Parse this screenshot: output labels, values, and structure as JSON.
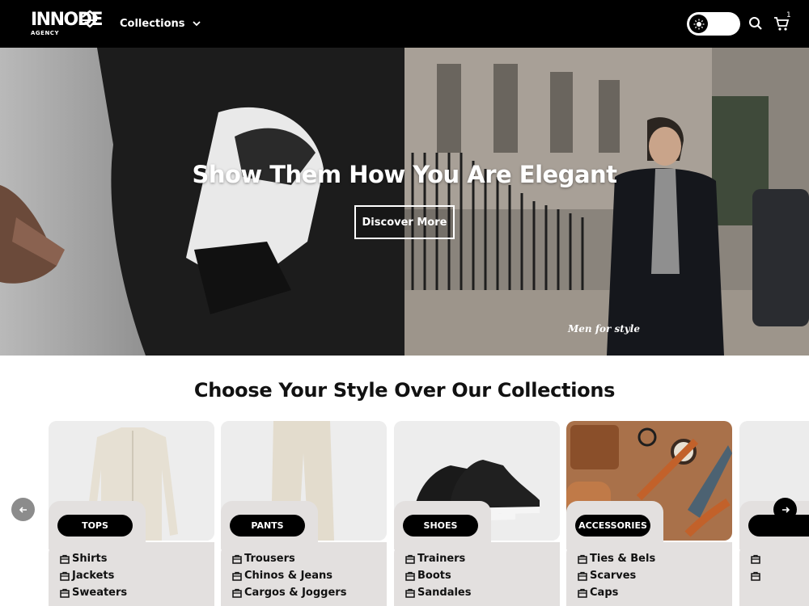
{
  "header": {
    "logo_main": "INNODE",
    "logo_sub": "AGENCY",
    "nav_collections": "Collections",
    "cart_count": "1"
  },
  "hero": {
    "title": "Show Them How You Are Elegant",
    "cta": "Discover More",
    "watermark": "Men for style"
  },
  "collections": {
    "title": "Choose Your Style Over Our Collections",
    "cards": [
      {
        "tag": "TOPS",
        "links": [
          "Shirts",
          "Jackets",
          "Sweaters"
        ]
      },
      {
        "tag": "PANTS",
        "links": [
          "Trousers",
          "Chinos & Jeans",
          "Cargos & Joggers"
        ]
      },
      {
        "tag": "SHOES",
        "links": [
          "Trainers",
          "Boots",
          "Sandales"
        ]
      },
      {
        "tag": "ACCESSORIES",
        "links": [
          "Ties & Bels",
          "Scarves",
          "Caps"
        ]
      }
    ]
  },
  "colors": {
    "header_bg": "#000000",
    "panel_bg": "#e3e0df",
    "tag_bg": "#000000"
  },
  "icons": [
    "logo-mark-icon",
    "chevron-down-icon",
    "sun-icon",
    "search-icon",
    "cart-icon",
    "bag-icon",
    "arrow-left-icon",
    "arrow-right-icon"
  ]
}
